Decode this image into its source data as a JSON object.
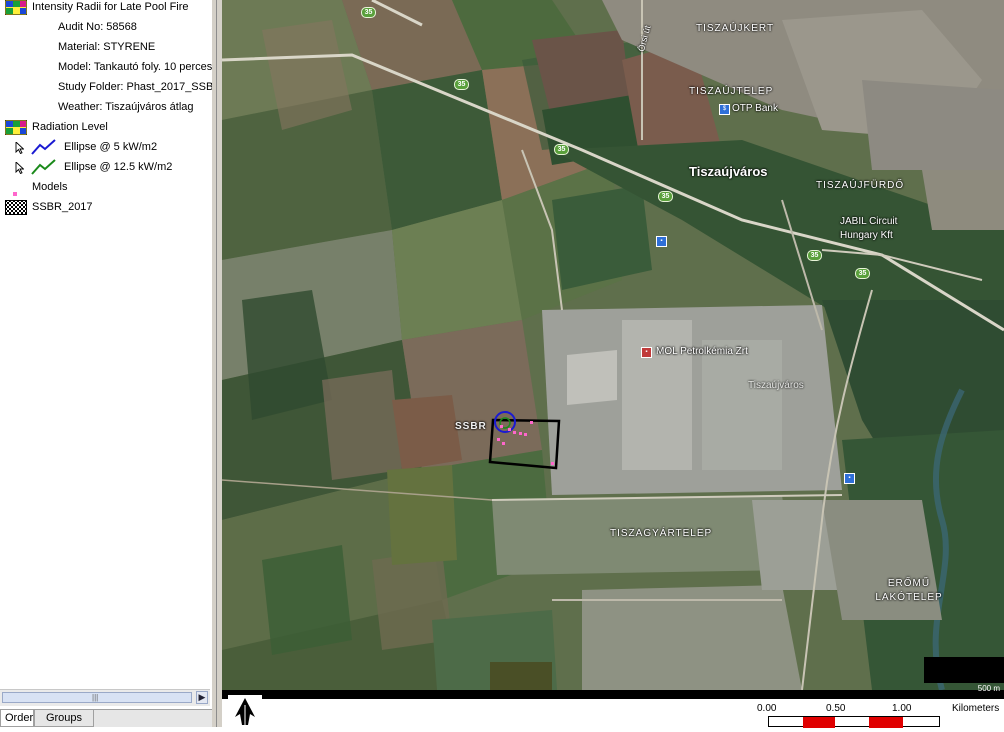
{
  "toc": {
    "layer1": {
      "title": "Intensity Radii for Late Pool Fire",
      "properties": [
        "Audit No: 58568",
        "Material: STYRENE",
        "Model: Tankautó foly. 10 perces",
        "Study Folder: Phast_2017_SSB",
        "Weather: Tiszaújváros átlag"
      ]
    },
    "layer2": {
      "title": "Radiation Level",
      "items": [
        {
          "label": "Ellipse @ 5 kW/m2",
          "color": "#1a1ad2"
        },
        {
          "label": "Ellipse @ 12.5 kW/m2",
          "color": "#1a8a1a"
        }
      ]
    },
    "layer3": {
      "title": "Models",
      "color": "#ff66cc"
    },
    "layer4": {
      "title": "SSBR_2017"
    }
  },
  "tabs": {
    "order": "Order",
    "groups": "Groups"
  },
  "map": {
    "labels": {
      "tiszaujkert": "TISZAÚJKERT",
      "tiszautelep": "TISZAÚJTELEP",
      "otp": "OTP Bank",
      "tiszaujvaros": "Tiszaújváros",
      "tiszafured": "TISZAÚJFÜRDŐ",
      "jabil": "JABIL Circuit Hungary Kft",
      "mol": "MOL Petrolkémia Zrt",
      "tiszaujvaros_small": "Tiszaújváros",
      "ssbr": "SSBR",
      "tiszagyartelep": "TISZAGYÁRTELEP",
      "eromu": "ERŐMŰ LAKÓTELEP",
      "orszagut": "Örsi út"
    },
    "roads": [
      "35",
      "35",
      "35",
      "35",
      "35",
      "35"
    ]
  },
  "scale": {
    "ticks": [
      "0.00",
      "0.50",
      "1.00"
    ],
    "unit": "Kilometers",
    "overlay": "500 m"
  }
}
